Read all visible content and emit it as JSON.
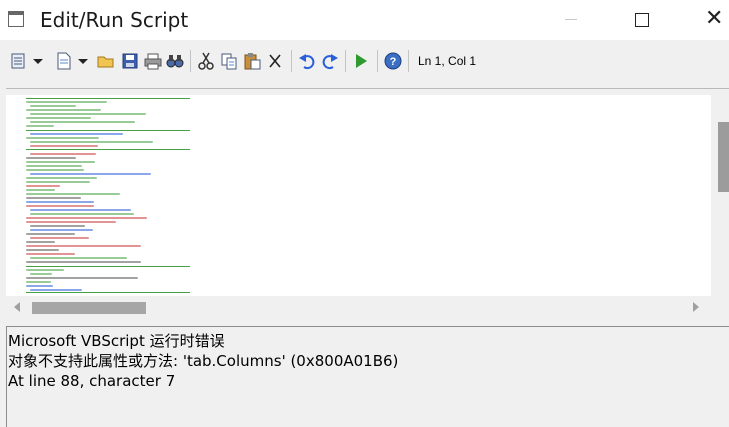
{
  "window": {
    "title": "Edit/Run Script",
    "minimize_glyph": "",
    "maximize_glyph": "",
    "close_glyph": "✕"
  },
  "toolbar": {
    "items": [
      {
        "name": "format-dropdown",
        "icon": "list-lines-icon"
      },
      {
        "name": "new-dropdown",
        "icon": "document-icon"
      },
      {
        "name": "open-button",
        "icon": "folder-icon"
      },
      {
        "name": "save-button",
        "icon": "floppy-icon"
      },
      {
        "name": "print-button",
        "icon": "printer-icon"
      },
      {
        "name": "find-button",
        "icon": "binoculars-icon"
      },
      {
        "name": "cut-button",
        "icon": "scissors-icon"
      },
      {
        "name": "copy-button",
        "icon": "copy-icon"
      },
      {
        "name": "paste-button",
        "icon": "clipboard-icon"
      },
      {
        "name": "delete-button",
        "icon": "x-icon"
      },
      {
        "name": "undo-button",
        "icon": "undo-icon"
      },
      {
        "name": "redo-button",
        "icon": "redo-icon"
      },
      {
        "name": "run-button",
        "icon": "play-icon"
      },
      {
        "name": "help-button",
        "icon": "help-icon"
      }
    ],
    "cursor_position": "Ln 1, Col 1"
  },
  "colors": {
    "comment_green": "#46a046",
    "keyword_blue": "#2b5fd9",
    "string_red": "#c83c3c"
  },
  "output": {
    "lines": [
      "Microsoft VBScript 运行时错误",
      "对象不支持此属性或方法: 'tab.Columns' (0x800A01B6)",
      "At line 88, character 7"
    ]
  }
}
